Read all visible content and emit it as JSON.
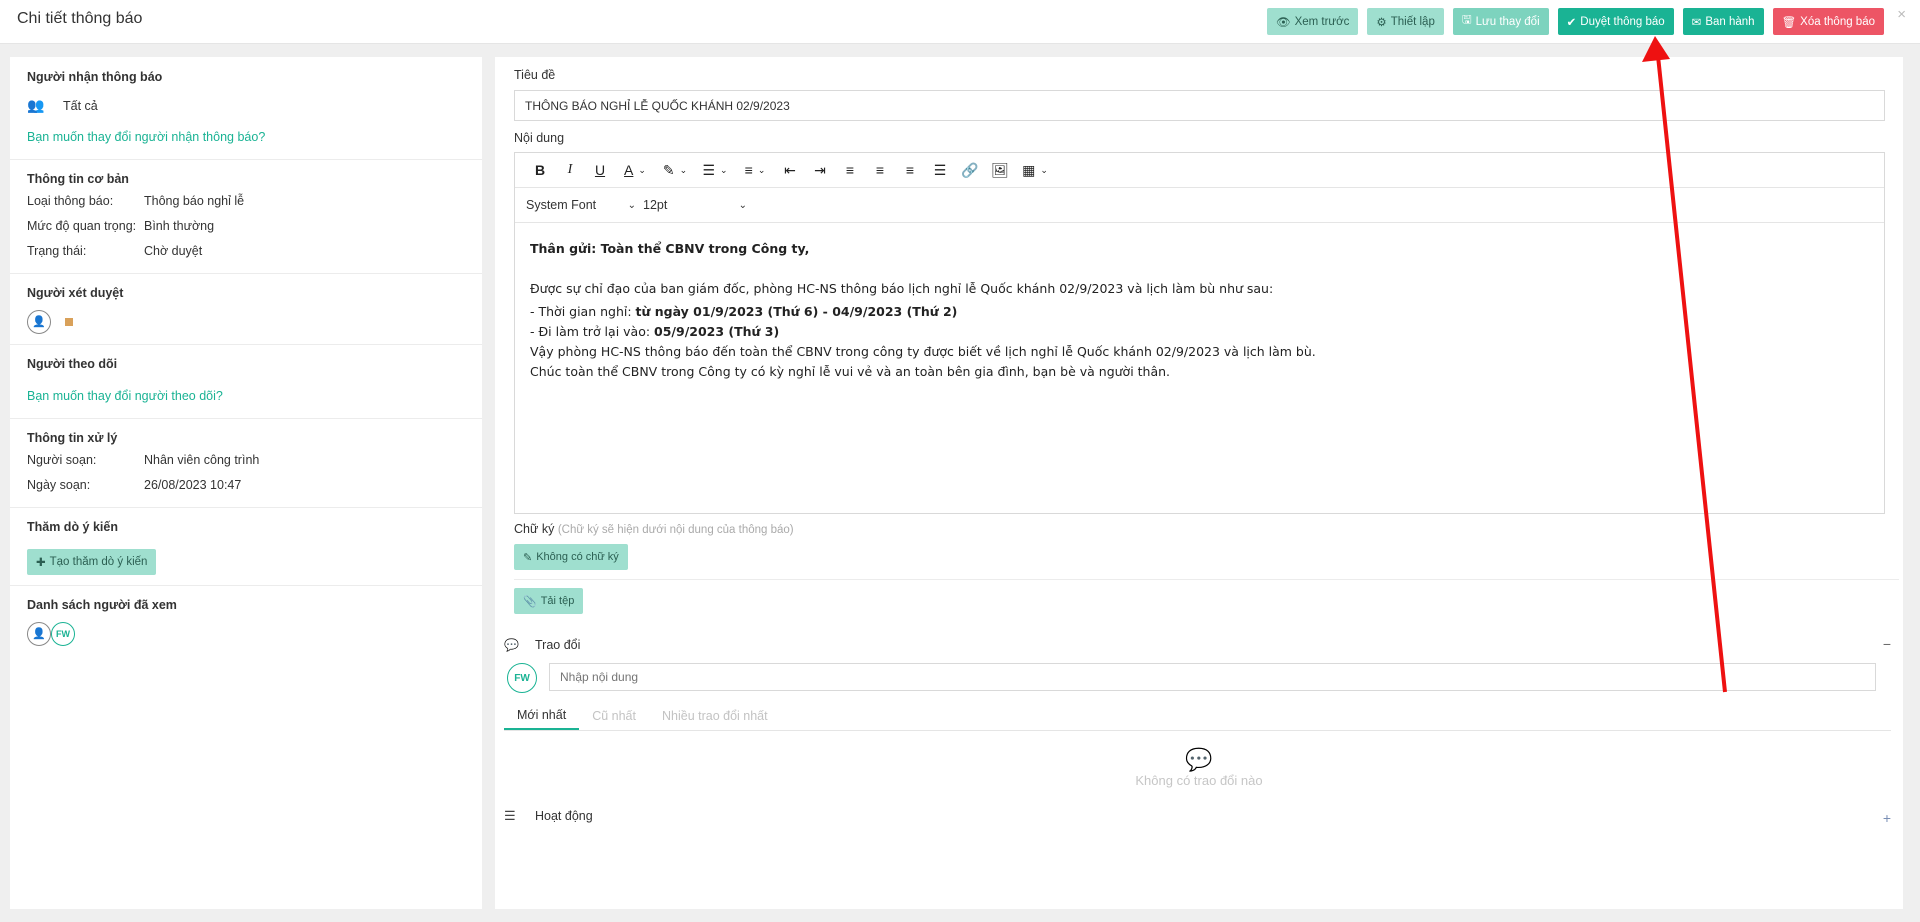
{
  "header": {
    "title": "Chi tiết thông báo",
    "buttons": {
      "preview": "Xem trước",
      "settings": "Thiết lập",
      "save": "Lưu thay đổi",
      "approve": "Duyệt thông báo",
      "publish": "Ban hành",
      "delete": "Xóa thông báo"
    },
    "close": "×"
  },
  "left": {
    "recipients": {
      "title": "Người nhận thông báo",
      "value": "Tất cả",
      "change_link": "Bạn muốn thay đổi người nhận thông báo?"
    },
    "basic": {
      "title": "Thông tin cơ bản",
      "rows": [
        {
          "label": "Loại thông báo:",
          "value": "Thông báo nghỉ lễ"
        },
        {
          "label": "Mức độ quan trọng:",
          "value": "Bình thường"
        },
        {
          "label": "Trạng thái:",
          "value": "Chờ duyệt"
        }
      ]
    },
    "reviewer": {
      "title": "Người xét duyệt"
    },
    "followers": {
      "title": "Người theo dõi",
      "change_link": "Bạn muốn thay đổi người theo dõi?"
    },
    "processing": {
      "title": "Thông tin xử lý",
      "rows": [
        {
          "label": "Người soạn:",
          "value": "Nhân viên công trình"
        },
        {
          "label": "Ngày soạn:",
          "value": "26/08/2023 10:47"
        }
      ]
    },
    "survey": {
      "title": "Thăm dò ý kiến",
      "button": "Tạo thăm dò ý kiến"
    },
    "viewers": {
      "title": "Danh sách người đã xem",
      "fw_badge": "FW"
    }
  },
  "main": {
    "title_label": "Tiêu đề",
    "title_value": "THÔNG BÁO NGHỈ LỄ QUỐC KHÁNH 02/9/2023",
    "content_label": "Nội dung",
    "editor": {
      "font": "System Font",
      "size": "12pt",
      "greeting": "Thân gửi: Toàn thể CBNV trong Công ty,",
      "para1": "Được sự chỉ đạo của ban giám đốc, phòng HC-NS thông báo lịch nghỉ lễ Quốc khánh 02/9/2023 và lịch làm bù như sau:",
      "line1_prefix": "- Thời gian nghỉ: ",
      "line1_bold": "từ ngày 01/9/2023 (Thứ 6) - 04/9/2023 (Thứ 2)",
      "line2_prefix": "- Đi làm trở lại vào: ",
      "line2_bold": "05/9/2023 (Thứ 3)",
      "para2": "Vậy phòng HC-NS thông báo đến toàn thể CBNV trong công ty được biết về lịch nghỉ lễ Quốc khánh 02/9/2023 và lịch làm bù.",
      "para3": "Chúc toàn thể CBNV trong Công ty có kỳ nghỉ lễ vui vẻ và an toàn bên gia đình, bạn bè và người thân."
    },
    "signature": {
      "label": "Chữ ký",
      "hint": "(Chữ ký sẽ hiện dưới nội dung của thông báo)",
      "button": "Không có chữ ký"
    },
    "upload_button": "Tải tệp",
    "discussion": {
      "title": "Trao đổi",
      "collapse": "−",
      "placeholder": "Nhập nội dung",
      "avatar": "FW",
      "tabs": [
        "Mới nhất",
        "Cũ nhất",
        "Nhiều trao đổi nhất"
      ],
      "empty": "Không có trao đổi nào"
    },
    "activity": {
      "title": "Hoạt động",
      "add": "+"
    }
  },
  "colors": {
    "accent": "#1ab394",
    "light": "#9fdfcf",
    "danger": "#ed5565",
    "arrow": "#ee1111"
  }
}
